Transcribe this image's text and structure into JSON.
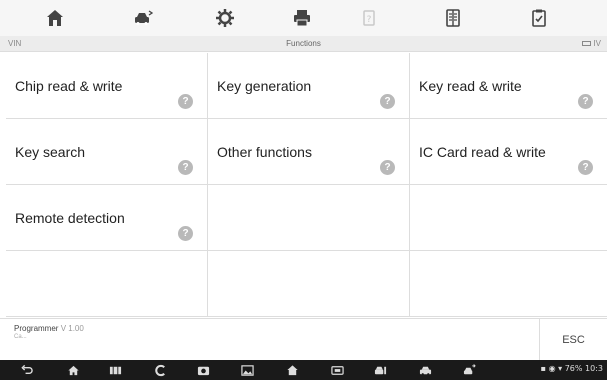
{
  "toolbar": {
    "icons": [
      "home-icon",
      "vehicle-swap-icon",
      "settings-gear-icon",
      "print-icon",
      "help-disabled-icon",
      "data-record-icon",
      "report-icon"
    ]
  },
  "subbar": {
    "vin_label": "VIN",
    "title": "Functions",
    "right_text": "IV"
  },
  "functions": [
    {
      "label": "Chip read & write",
      "help": "?"
    },
    {
      "label": "Key generation",
      "help": "?"
    },
    {
      "label": "Key read & write",
      "help": "?"
    },
    {
      "label": "Key search",
      "help": "?"
    },
    {
      "label": "Other functions",
      "help": "?"
    },
    {
      "label": "IC Card read & write",
      "help": "?"
    },
    {
      "label": "Remote detection",
      "help": "?"
    }
  ],
  "footer": {
    "program_name": "Programmer",
    "version": "V 1.00",
    "sub_text": "Ca...",
    "esc_label": "ESC"
  },
  "navbar": {
    "status_text": "76% 10:3"
  },
  "colors": {
    "background": "#ffffff",
    "toolbar_bg": "#f6f6f6",
    "subbar_bg": "#ececec",
    "help_badge": "#b9b9b9",
    "navbar_bg": "#1a1a1a"
  }
}
